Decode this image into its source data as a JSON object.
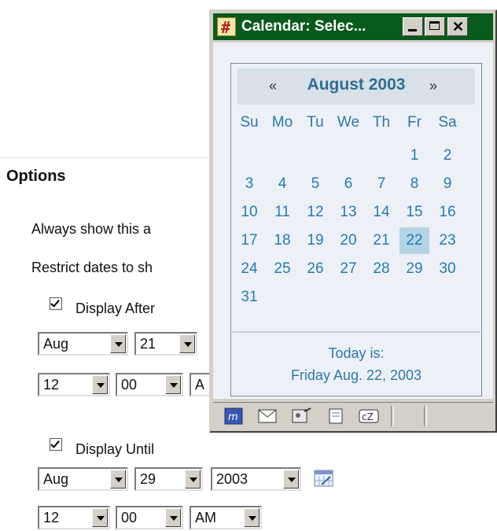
{
  "page": {
    "options_title": "Options",
    "always_show": "Always show this a",
    "restrict_dates": "Restrict dates to sh",
    "display_after_label": "Display After",
    "display_until_label": "Display Until",
    "after": {
      "month": "Aug",
      "day": "21",
      "hour": "12",
      "minute": "00",
      "ampm_partial": "A"
    },
    "until": {
      "month": "Aug",
      "day": "29",
      "year": "2003",
      "hour": "12",
      "minute": "00",
      "ampm": "AM"
    }
  },
  "window": {
    "title": "Calendar: Selec...",
    "minimize": "minimize",
    "maximize": "maximize",
    "close": "✕"
  },
  "calendar": {
    "prev": "«",
    "next": "»",
    "month_title": "August 2003",
    "weekdays": [
      "Su",
      "Mo",
      "Tu",
      "We",
      "Th",
      "Fr",
      "Sa"
    ],
    "weeks": [
      [
        "",
        "",
        "",
        "",
        "",
        "1",
        "2"
      ],
      [
        "3",
        "4",
        "5",
        "6",
        "7",
        "8",
        "9"
      ],
      [
        "10",
        "11",
        "12",
        "13",
        "14",
        "15",
        "16"
      ],
      [
        "17",
        "18",
        "19",
        "20",
        "21",
        "22",
        "23"
      ],
      [
        "24",
        "25",
        "26",
        "27",
        "28",
        "29",
        "30"
      ],
      [
        "31",
        "",
        "",
        "",
        "",
        "",
        ""
      ]
    ],
    "selected_day": "22",
    "today_label": "Today is:",
    "today_value": "Friday Aug. 22, 2003"
  },
  "colors": {
    "title_bar": "#0a5a1e",
    "calendar_text": "#1f7fae",
    "selected_day_bg": "#b3d5e5",
    "calendar_bg": "#eef0f8"
  }
}
